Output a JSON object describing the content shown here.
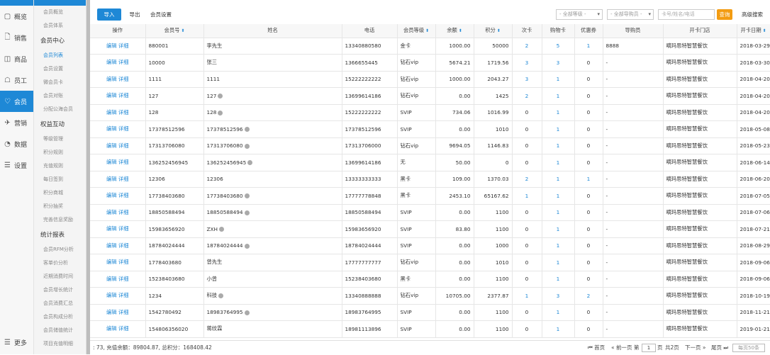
{
  "nav": {
    "items": [
      {
        "icon": "▢",
        "label": "概览"
      },
      {
        "icon": "🗋",
        "label": "销售"
      },
      {
        "icon": "◫",
        "label": "商品"
      },
      {
        "icon": "☖",
        "label": "员工"
      },
      {
        "icon": "♡",
        "label": "会员"
      },
      {
        "icon": "✈",
        "label": "营销"
      },
      {
        "icon": "◔",
        "label": "数据"
      },
      {
        "icon": "☰",
        "label": "设置"
      }
    ],
    "bottom": {
      "icon": "☰",
      "label": "更多"
    }
  },
  "subnav": {
    "top": [
      "会员概览",
      "会员体系"
    ],
    "groups": [
      {
        "title": "会员中心",
        "items": [
          "会员列表",
          "会员设置",
          "微会员卡",
          "会员对账",
          "分配公海会员"
        ]
      },
      {
        "title": "权益互动",
        "items": [
          "等级管理",
          "积分规则",
          "充值规则",
          "每日签到",
          "积分商城",
          "积分抽奖",
          "完善信息奖励"
        ]
      },
      {
        "title": "统计报表",
        "items": [
          "会员RFM分析",
          "客单价分析",
          "近期消费时间",
          "会员增长统计",
          "会员消费汇总",
          "会员构成分析",
          "会员储值统计",
          "项目充值明细"
        ]
      }
    ]
  },
  "toolbar": {
    "import": "导入",
    "export": "导出",
    "settings": "会员设置",
    "level_select": "- 全部等级 -",
    "shopper_select": "- 全部导购员 -",
    "search_placeholder": "卡号/姓名/电话",
    "search_btn": "查询",
    "advanced": "高级搜索"
  },
  "table": {
    "headers": [
      "操作",
      "会员号",
      "姓名",
      "电话",
      "会员等级",
      "余额",
      "积分",
      "次卡",
      "购物卡",
      "优惠券",
      "导购员",
      "开卡门店",
      "开卡日期"
    ],
    "edit": "编辑",
    "detail": "详细",
    "rows": [
      [
        "880001",
        "李先生",
        "13340880580",
        "金卡",
        "1000.00",
        "50000",
        "2",
        "5",
        "1",
        "8888",
        "嘀玛思特智慧餐饮",
        "2018-03-29"
      ],
      [
        "10000",
        "张三",
        "1366655445",
        "钻石vip",
        "5674.21",
        "1719.56",
        "3",
        "3",
        "0",
        "-",
        "嘀玛思特智慧餐饮",
        "2018-03-30"
      ],
      [
        "1111",
        "1111",
        "15222222222",
        "钻石vip",
        "1000.00",
        "2043.27",
        "3",
        "1",
        "0",
        "-",
        "嘀玛思特智慧餐饮",
        "2018-04-20"
      ],
      [
        "127",
        "127",
        "13699614186",
        "钻石vip",
        "0.00",
        "1425",
        "2",
        "1",
        "0",
        "-",
        "嘀玛思特智慧餐饮",
        "2018-04-20"
      ],
      [
        "128",
        "128",
        "15222222222",
        "SVIP",
        "734.06",
        "1016.99",
        "0",
        "1",
        "0",
        "-",
        "嘀玛思特智慧餐饮",
        "2018-04-20"
      ],
      [
        "17378512596",
        "17378512596",
        "17378512596",
        "SVIP",
        "0.00",
        "1010",
        "0",
        "1",
        "0",
        "-",
        "嘀玛思特智慧餐饮",
        "2018-05-08"
      ],
      [
        "17313706080",
        "17313706080",
        "17313706000",
        "钻石vip",
        "9694.05",
        "1146.83",
        "0",
        "1",
        "0",
        "-",
        "嘀玛思特智慧餐饮",
        "2018-05-23"
      ],
      [
        "136252456945",
        "136252456945",
        "13699614186",
        "无",
        "50.00",
        "0",
        "0",
        "1",
        "0",
        "-",
        "嘀玛思特智慧餐饮",
        "2018-06-14"
      ],
      [
        "12306",
        "12306",
        "13333333333",
        "黑卡",
        "109.00",
        "1370.03",
        "2",
        "1",
        "1",
        "-",
        "嘀玛思特智慧餐饮",
        "2018-06-20"
      ],
      [
        "17738403680",
        "17738403680",
        "17777778848",
        "黑卡",
        "2453.10",
        "65167.62",
        "1",
        "1",
        "0",
        "-",
        "嘀玛思特智慧餐饮",
        "2018-07-05"
      ],
      [
        "18850588494",
        "18850588494",
        "18850588494",
        "SVIP",
        "0.00",
        "1100",
        "0",
        "1",
        "0",
        "-",
        "嘀玛思特智慧餐饮",
        "2018-07-06"
      ],
      [
        "15983656920",
        "ZXH",
        "15983656920",
        "SVIP",
        "83.80",
        "1100",
        "0",
        "1",
        "0",
        "-",
        "嘀玛思特智慧餐饮",
        "2018-07-21"
      ],
      [
        "18784024444",
        "18784024444",
        "18784024444",
        "SVIP",
        "0.00",
        "1000",
        "0",
        "1",
        "0",
        "-",
        "嘀玛思特智慧餐饮",
        "2018-08-29"
      ],
      [
        "1778403680",
        "曾先生",
        "17777777777",
        "钻石vip",
        "0.00",
        "1010",
        "0",
        "1",
        "0",
        "-",
        "嘀玛思特智慧餐饮",
        "2018-09-06"
      ],
      [
        "15238403680",
        "小曾",
        "15238403680",
        "黑卡",
        "0.00",
        "1100",
        "0",
        "1",
        "0",
        "-",
        "嘀玛思特智慧餐饮",
        "2018-09-06"
      ],
      [
        "1234",
        "科技",
        "13340888888",
        "钻石vip",
        "10705.00",
        "2377.87",
        "1",
        "3",
        "2",
        "-",
        "嘀玛思特智慧餐饮",
        "2018-10-19"
      ],
      [
        "1542780492",
        "18983764995",
        "18983764995",
        "SVIP",
        "0.00",
        "1100",
        "0",
        "1",
        "0",
        "-",
        "嘀玛思特智慧餐饮",
        "2018-11-21"
      ],
      [
        "154806356020",
        "蒋纹霖",
        "18981113896",
        "SVIP",
        "0.00",
        "1100",
        "0",
        "1",
        "0",
        "-",
        "嘀玛思特智慧餐饮",
        "2019-01-21"
      ]
    ]
  },
  "footer": {
    "summary": ": 73, 充值余额：89804.87, 总积分：168408.42",
    "first": "首页",
    "prev": "« 前一页",
    "page_label": "第",
    "page_value": "1",
    "page_suffix": "页",
    "total": "共2页",
    "next": "下一页 »",
    "last": "尾页",
    "per_page": "每页50条"
  }
}
